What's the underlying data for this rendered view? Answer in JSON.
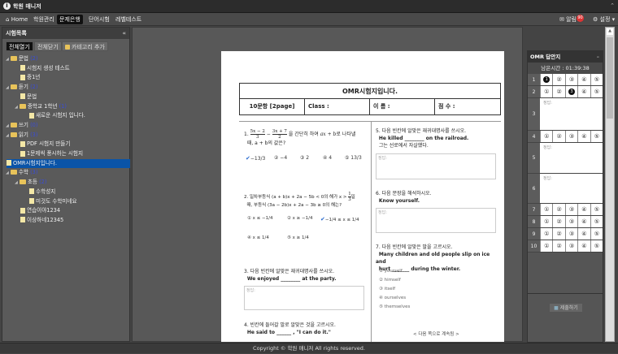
{
  "app": {
    "title": "학원 매니저"
  },
  "nav": {
    "items": [
      "Home",
      "학원관리",
      "문제은행",
      "단어시험",
      "레벨테스트"
    ],
    "active": "문제은행",
    "mail": "알림",
    "mail_badge": "90",
    "settings": "설정"
  },
  "sidebar": {
    "title": "시험목록",
    "collapse": "«",
    "buttons": {
      "expand_all": "전체열기",
      "collapse_all": "전체닫기",
      "add_category": "카테고리 추가"
    },
    "tree": [
      {
        "label": "문법",
        "count": "(2)",
        "type": "folder",
        "level": 0
      },
      {
        "label": "시험지 생성 테스트",
        "type": "doc",
        "level": 1
      },
      {
        "label": "중1년",
        "type": "doc",
        "level": 1
      },
      {
        "label": "듣기",
        "count": "(2)",
        "type": "folder",
        "level": 0
      },
      {
        "label": "문법",
        "type": "doc",
        "level": 1
      },
      {
        "label": "중학교 1학년",
        "count": "(1)",
        "type": "folder",
        "level": 1
      },
      {
        "label": "새로운 시험지 입니다.",
        "type": "doc",
        "level": 2
      },
      {
        "label": "쓰기",
        "count": "(0)",
        "type": "folder",
        "level": 0
      },
      {
        "label": "읽기",
        "count": "(3)",
        "type": "folder",
        "level": 0
      },
      {
        "label": "PDF 시험지 만들기",
        "type": "doc",
        "level": 1
      },
      {
        "label": "1문제씩 풍시하는 시험지",
        "type": "doc",
        "level": 1
      },
      {
        "label": "OMR시험지입니다.",
        "type": "doc",
        "level": 1,
        "selected": true
      },
      {
        "label": "수학",
        "count": "(3)",
        "type": "folder",
        "level": 0
      },
      {
        "label": "초등",
        "count": "(2)",
        "type": "folder",
        "level": 1
      },
      {
        "label": "수학성지",
        "type": "doc",
        "level": 2
      },
      {
        "label": "미것도 수학미네요",
        "type": "doc",
        "level": 2
      },
      {
        "label": "연습이야1234",
        "type": "doc",
        "level": 1
      },
      {
        "label": "이상하네12345",
        "type": "doc",
        "level": 1
      }
    ]
  },
  "paper": {
    "title": "OMR시험지입니다.",
    "info": [
      "10문항 [2page]",
      "Class :",
      "이 름 :",
      "점 수 :"
    ],
    "q1": {
      "num": "1.",
      "text": "을 간단히 하여",
      "text2": "로 나타낼",
      "line2": "때, a + b의 값은?",
      "opts": [
        "−13/3",
        "② −4",
        "③ 2",
        "④ 4",
        "⑤ 13/3"
      ]
    },
    "q2": {
      "num": "2.",
      "text": "일차부등식 (a + b)x + 2a − 5b < 0의 해가 x >",
      "text2": "일",
      "line2": "때, 부등식 (3a − 2b)x + 2a − 3b ≥ 0의 해는?",
      "opts": [
        "① x ≤ −1/4",
        "② x ≥ −1/4",
        "−1/4 ≤ x ≤ 1/4",
        "④ x ≤ 1/4",
        "⑤ x ≥ 1/4"
      ]
    },
    "q3": {
      "num": "3.",
      "text": "다음 빈칸에 알맞은 재귀대명사를 쓰시오.",
      "sub": "We enjoyed ________ at the party.",
      "answer_label": "정답:"
    },
    "q4": {
      "num": "4.",
      "text": "빈칸에 들어갈 말로 알맞은 것을 고르시오.",
      "sub": "He said to ______ , \"I can do it.\""
    },
    "q5": {
      "num": "5.",
      "text": "다음 빈칸에 알맞은 재귀대명사를 쓰시오.",
      "sub": "He killed ________ on the railroad.",
      "sub2": "그는 선로에서 자살했다.",
      "answer_label": "정답:"
    },
    "q6": {
      "num": "6.",
      "text": "다음 문장을 해석하시오.",
      "sub": "Know yourself.",
      "answer_label": "정답:"
    },
    "q7": {
      "num": "7.",
      "text": "다음 빈칸에 알맞은 말을 고르시오.",
      "sub": "Many children and old people slip on ice and",
      "sub2": "hurt _______ during the winter.",
      "opts": [
        "① yourself",
        "② himself",
        "③ itself",
        "④ ourselves",
        "⑤ themselves"
      ]
    },
    "continue": "< 다음 쪽으로 계속됨 >"
  },
  "omr": {
    "title": "OMR 답안지",
    "time": "남은시간 : 01:39:38",
    "answer_label": "정답:",
    "choices": [
      "①",
      "②",
      "③",
      "④",
      "⑤"
    ],
    "rows": [
      {
        "n": "1",
        "type": "mc",
        "selected": 1
      },
      {
        "n": "2",
        "type": "mc",
        "selected": 3
      },
      {
        "n": "3",
        "type": "text"
      },
      {
        "n": "4",
        "type": "mc"
      },
      {
        "n": "5",
        "type": "text"
      },
      {
        "n": "6",
        "type": "text"
      },
      {
        "n": "7",
        "type": "mc"
      },
      {
        "n": "8",
        "type": "mc"
      },
      {
        "n": "9",
        "type": "mc"
      },
      {
        "n": "10",
        "type": "mc"
      }
    ],
    "submit": "제출하기"
  },
  "footer": {
    "text": "Copyright © 학원 매니저 All rights reserved."
  }
}
